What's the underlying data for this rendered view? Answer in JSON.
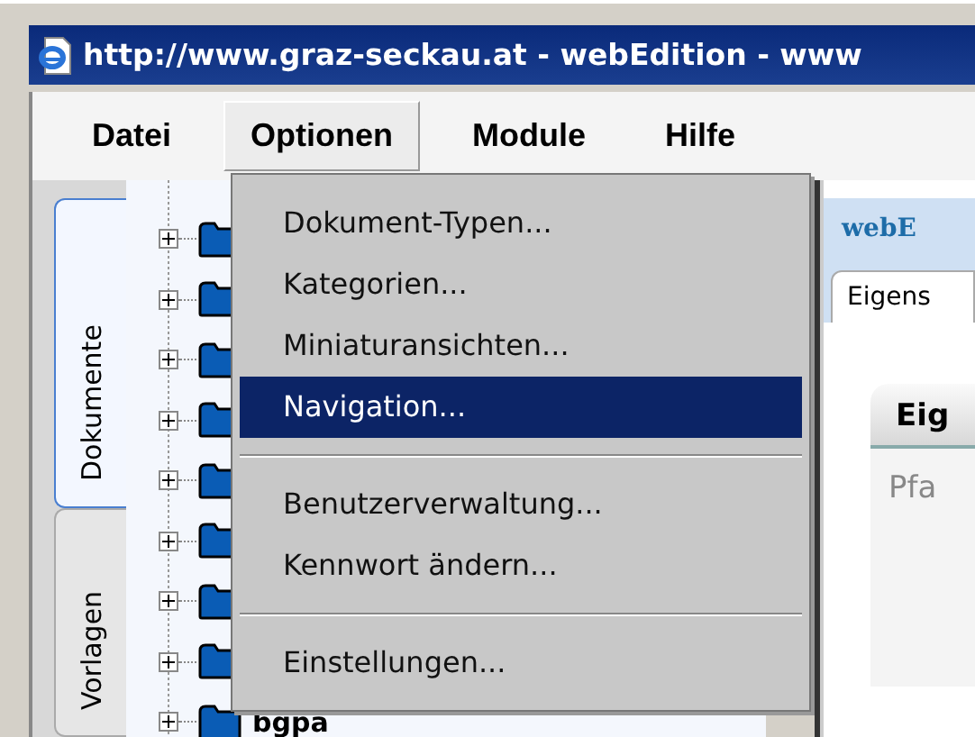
{
  "window": {
    "title": "http://www.graz-seckau.at - webEdition - www"
  },
  "menubar": [
    {
      "label": "Datei",
      "selected": false
    },
    {
      "label": "Optionen",
      "selected": true
    },
    {
      "label": "Module",
      "selected": false
    },
    {
      "label": "Hilfe",
      "selected": false
    }
  ],
  "side_tabs": [
    {
      "label": "Dokumente",
      "selected": true
    },
    {
      "label": "Vorlagen",
      "selected": false
    }
  ],
  "tree": {
    "items": [
      {
        "expanded": false
      },
      {
        "expanded": false
      },
      {
        "expanded": false
      },
      {
        "expanded": false
      },
      {
        "expanded": false
      },
      {
        "expanded": false
      },
      {
        "expanded": false
      },
      {
        "expanded": false
      },
      {
        "label": "bgpa",
        "expanded": false
      }
    ]
  },
  "editor": {
    "header": "webE",
    "tab": "Eigens",
    "section": "Eig",
    "field_label": "Pfa"
  },
  "menu": [
    {
      "kind": "item",
      "label": "Dokument-Typen...",
      "selected": false
    },
    {
      "kind": "item",
      "label": "Kategorien...",
      "selected": false
    },
    {
      "kind": "item",
      "label": "Miniaturansichten...",
      "selected": false
    },
    {
      "kind": "item",
      "label": "Navigation...",
      "selected": true
    },
    {
      "kind": "separator"
    },
    {
      "kind": "item",
      "label": "Benutzerverwaltung...",
      "selected": false
    },
    {
      "kind": "item",
      "label": "Kennwort ändern...",
      "selected": false
    },
    {
      "kind": "separator"
    },
    {
      "kind": "item",
      "label": "Einstellungen...",
      "selected": false
    }
  ]
}
